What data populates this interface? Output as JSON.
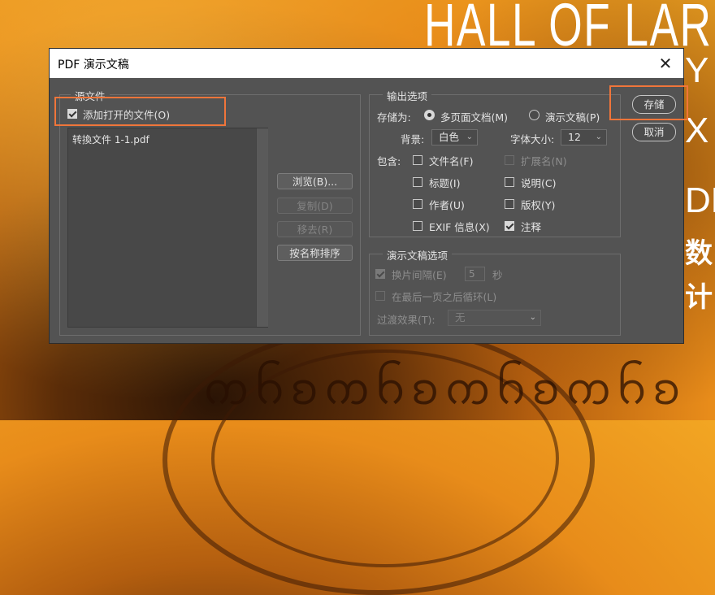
{
  "background": {
    "headline": "HALL OF LAR",
    "side_letters": [
      "Y",
      "X",
      "DE"
    ],
    "side_chars": [
      "数",
      "计"
    ]
  },
  "dialog": {
    "title": "PDF 演示文稿",
    "close_glyph": "✕",
    "source": {
      "legend": "源文件",
      "add_open_files": {
        "label": "添加打开的文件(O)",
        "checked": true
      },
      "files": [
        "转換文件 1-1.pdf"
      ],
      "buttons": {
        "browse": "浏览(B)...",
        "duplicate": "复制(D)",
        "remove": "移去(R)",
        "sort_by_name": "按名称排序"
      }
    },
    "output": {
      "legend": "输出选项",
      "save_as_label": "存储为:",
      "multipage": "多页面文档(M)",
      "presentation": "演示文稿(P)",
      "background_label": "背景:",
      "background_value": "白色",
      "font_size_label": "字体大小:",
      "font_size_value": "12",
      "include_label": "包含:",
      "options": {
        "filename": "文件名(F)",
        "extension": "扩展名(N)",
        "title": "标题(I)",
        "description": "说明(C)",
        "author": "作者(U)",
        "copyright": "版权(Y)",
        "exif": "EXIF 信息(X)",
        "notes": "注释"
      }
    },
    "presentation": {
      "legend": "演示文稿选项",
      "advance": "换片间隔(E)",
      "advance_value": "5",
      "seconds": "秒",
      "loop": "在最后一页之后循环(L)",
      "transition_label": "过渡效果(T):",
      "transition_value": "无"
    },
    "actions": {
      "save": "存储",
      "cancel": "取消"
    },
    "accent": "#f0753a"
  }
}
